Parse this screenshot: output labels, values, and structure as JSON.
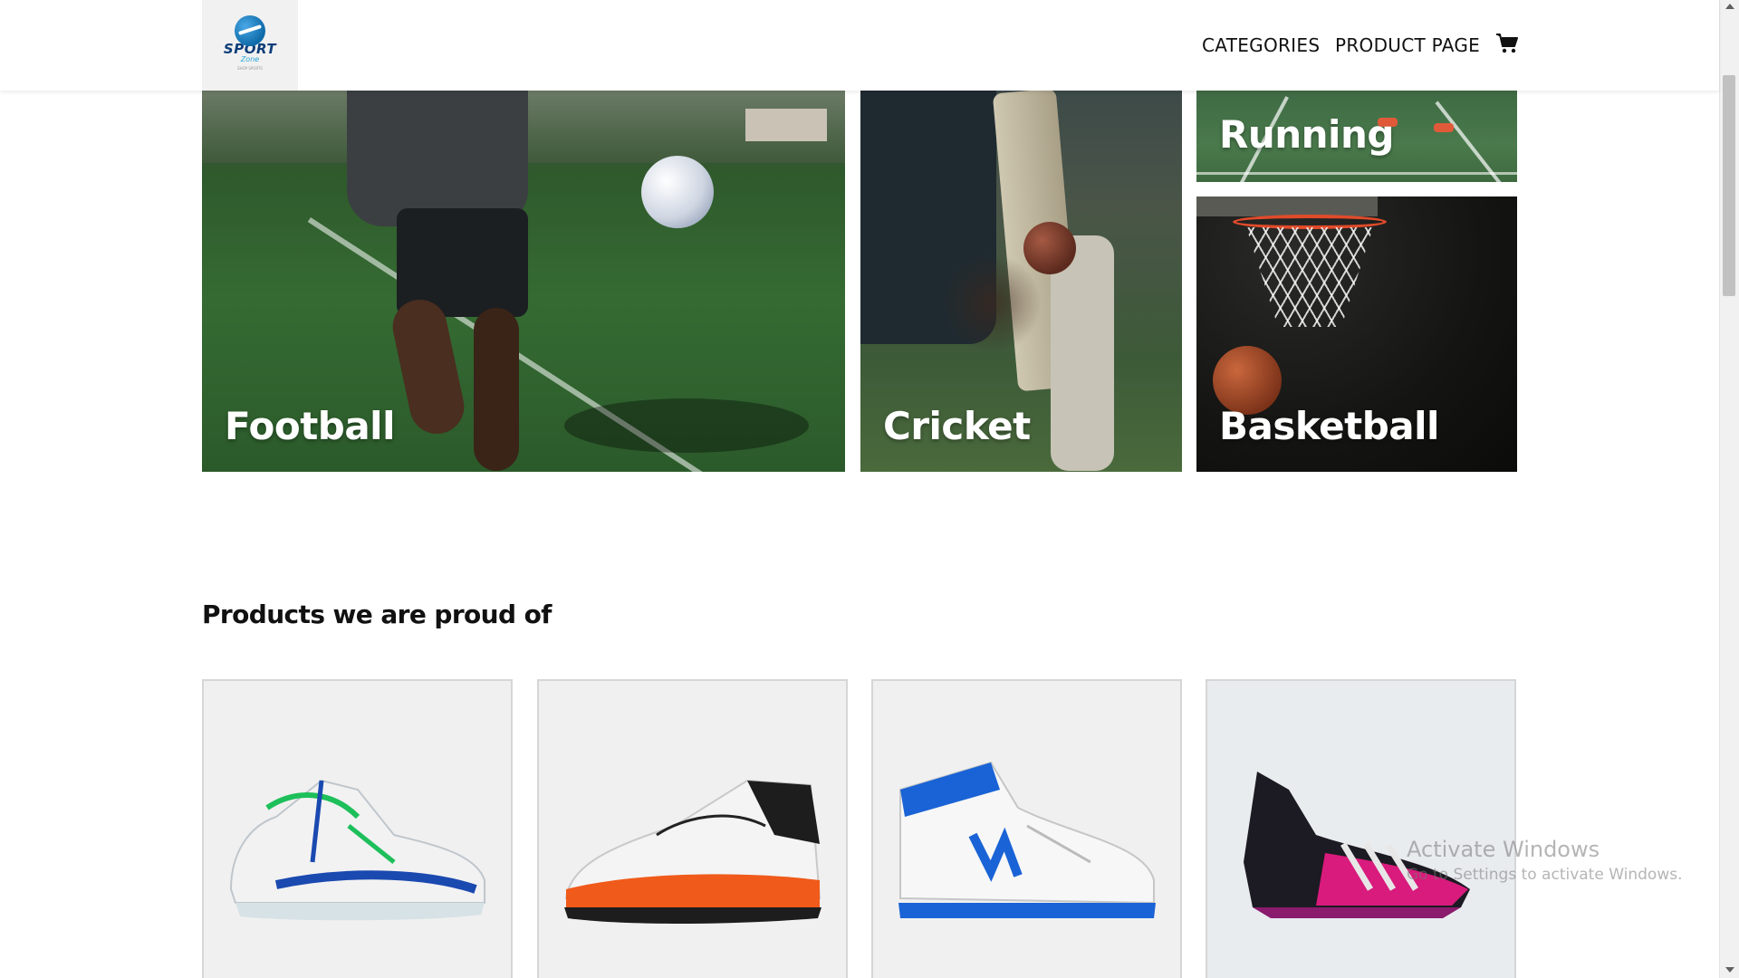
{
  "header": {
    "logo": {
      "name": "SPORT",
      "sub": "Zone",
      "tag": "SHOP SPORTS"
    },
    "nav": [
      {
        "label": "CATEGORIES"
      },
      {
        "label": "PRODUCT PAGE"
      }
    ],
    "cart_icon": "shopping-cart-icon"
  },
  "categories": [
    {
      "label": "Football"
    },
    {
      "label": "Cricket"
    },
    {
      "label": "Running"
    },
    {
      "label": "Basketball"
    }
  ],
  "products_section": {
    "title": "Products we are proud of"
  },
  "products": [
    {
      "image": "white-green-blue-basketball-shoe"
    },
    {
      "image": "white-orange-new-balance-shoe"
    },
    {
      "image": "white-blue-new-balance-650-high-top"
    },
    {
      "image": "black-pink-football-boot"
    }
  ],
  "watermark": {
    "title": "Activate Windows",
    "subtitle": "Go to Settings to activate Windows."
  },
  "colors": {
    "accent_blue": "#0d3e7a",
    "logo_cyan": "#27a7d8",
    "text": "#111111"
  }
}
